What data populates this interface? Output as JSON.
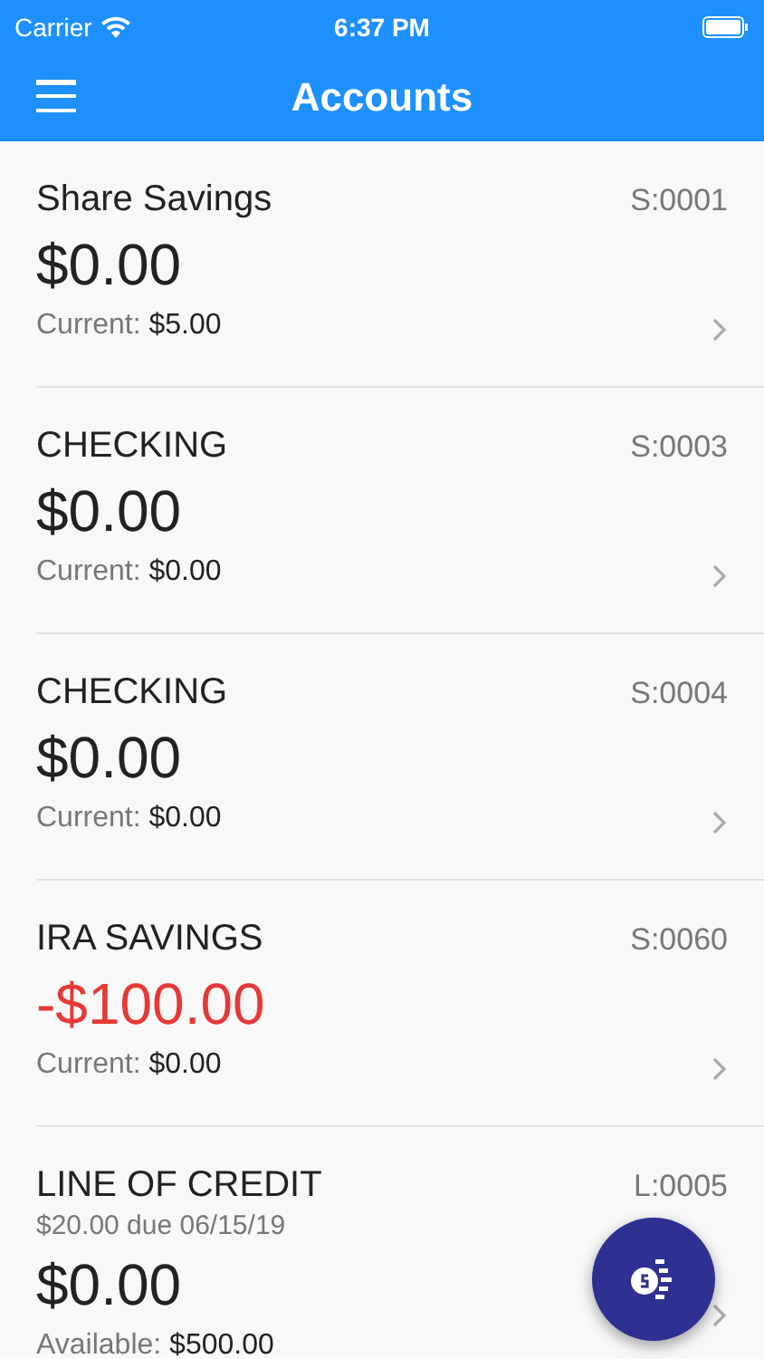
{
  "status_bar": {
    "carrier": "Carrier",
    "time": "6:37 PM"
  },
  "header": {
    "title": "Accounts"
  },
  "accounts": [
    {
      "name": "Share Savings",
      "code": "S:0001",
      "amount": "$0.00",
      "negative": false,
      "detail_label": "Current:",
      "detail_value": "$5.00"
    },
    {
      "name": "CHECKING",
      "code": "S:0003",
      "amount": "$0.00",
      "negative": false,
      "detail_label": "Current:",
      "detail_value": "$0.00"
    },
    {
      "name": "CHECKING",
      "code": "S:0004",
      "amount": "$0.00",
      "negative": false,
      "detail_label": "Current:",
      "detail_value": "$0.00"
    },
    {
      "name": "IRA SAVINGS",
      "code": "S:0060",
      "amount": "-$100.00",
      "negative": true,
      "detail_label": "Current:",
      "detail_value": "$0.00"
    },
    {
      "name": "LINE OF CREDIT",
      "code": "L:0005",
      "due": "$20.00 due 06/15/19",
      "amount": "$0.00",
      "negative": false,
      "detail_label": "Available:",
      "detail_value": "$500.00"
    }
  ]
}
